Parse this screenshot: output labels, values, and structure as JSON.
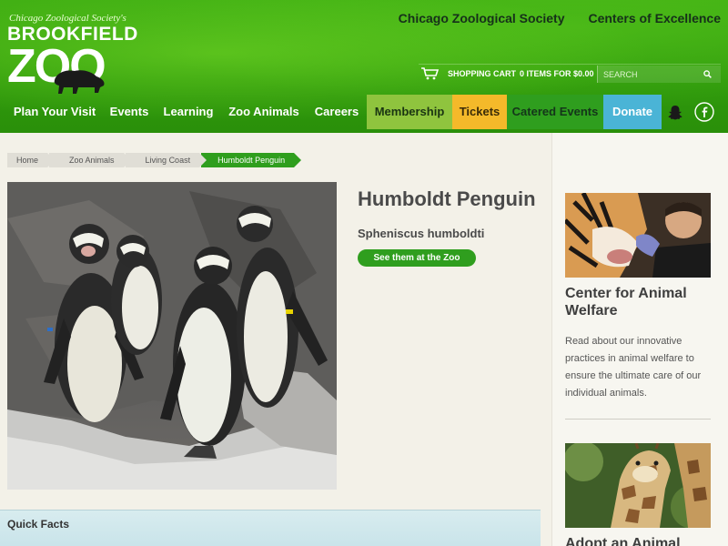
{
  "header": {
    "logo": {
      "society": "Chicago Zoological Society's",
      "brookfield": "BROOKFIELD",
      "zoo": "ZOO"
    },
    "top_links": [
      "Chicago Zoological Society",
      "Centers of Excellence"
    ],
    "cart": {
      "label": "SHOPPING CART",
      "summary": "0 ITEMS FOR $0.00"
    },
    "search": {
      "placeholder": "SEARCH"
    },
    "nav": {
      "plan": "Plan Your Visit",
      "events": "Events",
      "learning": "Learning",
      "animals": "Zoo Animals",
      "careers": "Careers",
      "membership": "Membership",
      "tickets": "Tickets",
      "catered": "Catered Events",
      "donate": "Donate"
    },
    "icons": [
      "snapchat-icon",
      "facebook-icon",
      "cart-icon",
      "search-icon"
    ]
  },
  "breadcrumb": [
    "Home",
    "Zoo Animals",
    "Living Coast",
    "Humboldt Penguin"
  ],
  "animal": {
    "name": "Humboldt Penguin",
    "scientific": "Spheniscus humboldti",
    "button": "See them at the Zoo"
  },
  "quick_facts": {
    "title": "Quick Facts"
  },
  "sidebar": {
    "item1": {
      "title": "Center for Animal Welfare",
      "text": "Read about our innovative practices in animal welfare to ensure the ultimate care of our individual animals."
    },
    "item2": {
      "title": "Adopt an Animal"
    }
  },
  "colors": {
    "brand_green": "#2f9e1e",
    "membership": "#8fc43e",
    "tickets": "#f4b92a",
    "donate": "#4ab4d6"
  }
}
